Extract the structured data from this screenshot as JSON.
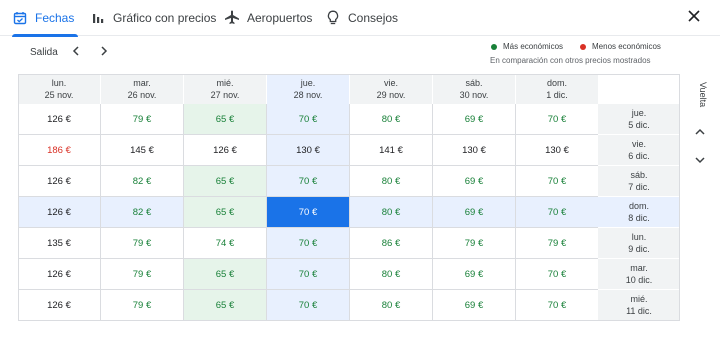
{
  "tabs": [
    {
      "label": "Fechas",
      "icon": "calendar-icon"
    },
    {
      "label": "Gráfico con precios",
      "icon": "bar-chart-icon"
    },
    {
      "label": "Aeropuertos",
      "icon": "airplane-icon"
    },
    {
      "label": "Consejos",
      "icon": "lightbulb-icon"
    }
  ],
  "salida_label": "Salida",
  "vuelta_label": "Vuelta",
  "legend": {
    "cheap": "Más económicos",
    "expensive": "Menos económicos",
    "note": "En comparación con otros precios mostrados",
    "cheap_color": "#188038",
    "expensive_color": "#d93025"
  },
  "departure_dates": [
    {
      "day": "lun.",
      "date": "25 nov."
    },
    {
      "day": "mar.",
      "date": "26 nov."
    },
    {
      "day": "mié.",
      "date": "27 nov."
    },
    {
      "day": "jue.",
      "date": "28 nov."
    },
    {
      "day": "vie.",
      "date": "29 nov."
    },
    {
      "day": "sáb.",
      "date": "30 nov."
    },
    {
      "day": "dom.",
      "date": "1 dic."
    }
  ],
  "return_dates": [
    {
      "day": "jue.",
      "date": "5 dic."
    },
    {
      "day": "vie.",
      "date": "6 dic."
    },
    {
      "day": "sáb.",
      "date": "7 dic."
    },
    {
      "day": "dom.",
      "date": "8 dic."
    },
    {
      "day": "lun.",
      "date": "9 dic."
    },
    {
      "day": "mar.",
      "date": "10 dic."
    },
    {
      "day": "mié.",
      "date": "11 dic."
    }
  ],
  "prices": [
    [
      {
        "v": "126 €",
        "t": "mid"
      },
      {
        "v": "79 €",
        "t": "low"
      },
      {
        "v": "65 €",
        "t": "low"
      },
      {
        "v": "70 €",
        "t": "low"
      },
      {
        "v": "80 €",
        "t": "low"
      },
      {
        "v": "69 €",
        "t": "low"
      },
      {
        "v": "70 €",
        "t": "low"
      }
    ],
    [
      {
        "v": "186 €",
        "t": "high"
      },
      {
        "v": "145 €",
        "t": "mid"
      },
      {
        "v": "126 €",
        "t": "mid"
      },
      {
        "v": "130 €",
        "t": "mid"
      },
      {
        "v": "141 €",
        "t": "mid"
      },
      {
        "v": "130 €",
        "t": "mid"
      },
      {
        "v": "130 €",
        "t": "mid"
      }
    ],
    [
      {
        "v": "126 €",
        "t": "mid"
      },
      {
        "v": "82 €",
        "t": "low"
      },
      {
        "v": "65 €",
        "t": "low"
      },
      {
        "v": "70 €",
        "t": "low"
      },
      {
        "v": "80 €",
        "t": "low"
      },
      {
        "v": "69 €",
        "t": "low"
      },
      {
        "v": "70 €",
        "t": "low"
      }
    ],
    [
      {
        "v": "126 €",
        "t": "mid"
      },
      {
        "v": "82 €",
        "t": "low"
      },
      {
        "v": "65 €",
        "t": "low"
      },
      {
        "v": "70 €",
        "t": "low"
      },
      {
        "v": "80 €",
        "t": "low"
      },
      {
        "v": "69 €",
        "t": "low"
      },
      {
        "v": "70 €",
        "t": "low"
      }
    ],
    [
      {
        "v": "135 €",
        "t": "mid"
      },
      {
        "v": "79 €",
        "t": "low"
      },
      {
        "v": "74 €",
        "t": "low"
      },
      {
        "v": "70 €",
        "t": "low"
      },
      {
        "v": "86 €",
        "t": "low"
      },
      {
        "v": "79 €",
        "t": "low"
      },
      {
        "v": "79 €",
        "t": "low"
      }
    ],
    [
      {
        "v": "126 €",
        "t": "mid"
      },
      {
        "v": "79 €",
        "t": "low"
      },
      {
        "v": "65 €",
        "t": "low"
      },
      {
        "v": "70 €",
        "t": "low"
      },
      {
        "v": "80 €",
        "t": "low"
      },
      {
        "v": "69 €",
        "t": "low"
      },
      {
        "v": "70 €",
        "t": "low"
      }
    ],
    [
      {
        "v": "126 €",
        "t": "mid"
      },
      {
        "v": "79 €",
        "t": "low"
      },
      {
        "v": "65 €",
        "t": "low"
      },
      {
        "v": "70 €",
        "t": "low"
      },
      {
        "v": "80 €",
        "t": "low"
      },
      {
        "v": "69 €",
        "t": "low"
      },
      {
        "v": "70 €",
        "t": "low"
      }
    ]
  ],
  "selected": {
    "departure_index": 3,
    "return_index": 3
  },
  "cheapest_cells": [
    [
      0,
      2
    ],
    [
      2,
      2
    ],
    [
      3,
      2
    ],
    [
      5,
      2
    ],
    [
      6,
      2
    ]
  ]
}
